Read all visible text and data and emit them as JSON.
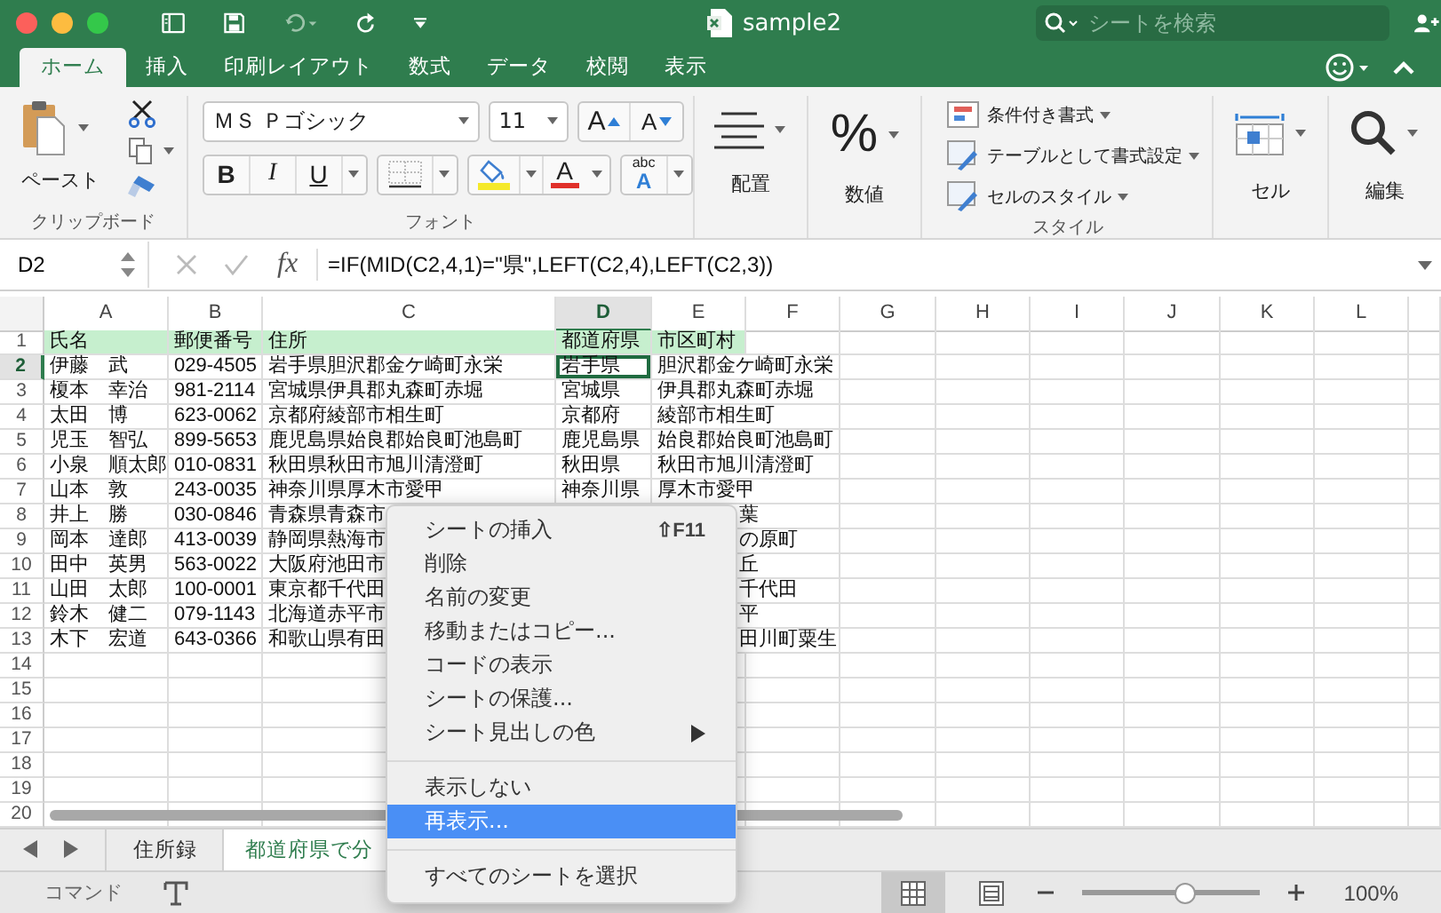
{
  "window": {
    "title": "sample2"
  },
  "search": {
    "placeholder": "シートを検索"
  },
  "tabs": [
    {
      "label": "ホーム",
      "selected": true
    },
    {
      "label": "挿入",
      "selected": false
    },
    {
      "label": "印刷レイアウト",
      "selected": false
    },
    {
      "label": "数式",
      "selected": false
    },
    {
      "label": "データ",
      "selected": false
    },
    {
      "label": "校閲",
      "selected": false
    },
    {
      "label": "表示",
      "selected": false
    }
  ],
  "ribbon": {
    "clipboard": {
      "paste": "ペースト",
      "label": "クリップボード"
    },
    "font": {
      "name": "ＭＳ Ｐゴシック",
      "size": "11",
      "grow": "A",
      "shrink": "A",
      "bold": "B",
      "italic": "I",
      "underline": "U",
      "font_color": "A",
      "phonetic_top": "abc",
      "phonetic_letter": "A",
      "label": "フォント"
    },
    "alignment": {
      "label": "配置"
    },
    "number": {
      "symbol": "%",
      "label": "数値"
    },
    "styles": {
      "items": [
        "条件付き書式",
        "テーブルとして書式設定",
        "セルのスタイル"
      ],
      "label": "スタイル"
    },
    "cells": {
      "label": "セル"
    },
    "editing": {
      "label": "編集"
    }
  },
  "formula_bar": {
    "name_box": "D2",
    "fx": "fx",
    "formula": "=IF(MID(C2,4,1)=\"県\",LEFT(C2,4),LEFT(C2,3))"
  },
  "sheet": {
    "columns": [
      {
        "label": "A",
        "selected": false
      },
      {
        "label": "B",
        "selected": false
      },
      {
        "label": "C",
        "selected": false
      },
      {
        "label": "D",
        "selected": true
      },
      {
        "label": "E",
        "selected": false
      },
      {
        "label": "F",
        "selected": false
      },
      {
        "label": "G",
        "selected": false
      },
      {
        "label": "H",
        "selected": false
      },
      {
        "label": "I",
        "selected": false
      },
      {
        "label": "J",
        "selected": false
      },
      {
        "label": "K",
        "selected": false
      },
      {
        "label": "L",
        "selected": false
      }
    ],
    "rows": [
      {
        "num": "1",
        "selected": false,
        "kind": "header",
        "cells": [
          "氏名",
          "郵便番号",
          "住所",
          "都道府県",
          "市区町村"
        ]
      },
      {
        "num": "2",
        "selected": true,
        "kind": "data",
        "cells": [
          "伊藤　武",
          "029-4505",
          "岩手県胆沢郡金ケ崎町永栄",
          "岩手県",
          "胆沢郡金ケ崎町永栄"
        ]
      },
      {
        "num": "3",
        "selected": false,
        "kind": "data",
        "cells": [
          "榎本　幸治",
          "981-2114",
          "宮城県伊具郡丸森町赤堀",
          "宮城県",
          "伊具郡丸森町赤堀"
        ]
      },
      {
        "num": "4",
        "selected": false,
        "kind": "data",
        "cells": [
          "太田　博",
          "623-0062",
          "京都府綾部市相生町",
          "京都府",
          "綾部市相生町"
        ]
      },
      {
        "num": "5",
        "selected": false,
        "kind": "data",
        "cells": [
          "児玉　智弘",
          "899-5653",
          "鹿児島県始良郡始良町池島町",
          "鹿児島県",
          "始良郡始良町池島町"
        ]
      },
      {
        "num": "6",
        "selected": false,
        "kind": "data",
        "cells": [
          "小泉　順太郎",
          "010-0831",
          "秋田県秋田市旭川清澄町",
          "秋田県",
          "秋田市旭川清澄町"
        ]
      },
      {
        "num": "7",
        "selected": false,
        "kind": "data",
        "cells": [
          "山本　敦",
          "243-0035",
          "神奈川県厚木市愛甲",
          "神奈川県",
          "厚木市愛甲"
        ]
      },
      {
        "num": "8",
        "selected": false,
        "kind": "data",
        "cells": [
          "井上　勝",
          "030-0846",
          "青森県青森市",
          null,
          "葉"
        ]
      },
      {
        "num": "9",
        "selected": false,
        "kind": "data",
        "cells": [
          "岡本　達郎",
          "413-0039",
          "静岡県熱海市",
          null,
          "の原町"
        ]
      },
      {
        "num": "10",
        "selected": false,
        "kind": "data",
        "cells": [
          "田中　英男",
          "563-0022",
          "大阪府池田市",
          null,
          "丘"
        ]
      },
      {
        "num": "11",
        "selected": false,
        "kind": "data",
        "cells": [
          "山田　太郎",
          "100-0001",
          "東京都千代田",
          null,
          "千代田"
        ]
      },
      {
        "num": "12",
        "selected": false,
        "kind": "data",
        "cells": [
          "鈴木　健二",
          "079-1143",
          "北海道赤平市",
          null,
          "平"
        ]
      },
      {
        "num": "13",
        "selected": false,
        "kind": "data",
        "cells": [
          "木下　宏道",
          "643-0366",
          "和歌山県有田",
          null,
          "田川町粟生"
        ]
      },
      {
        "num": "14",
        "selected": false,
        "kind": "empty"
      },
      {
        "num": "15",
        "selected": false,
        "kind": "empty"
      },
      {
        "num": "16",
        "selected": false,
        "kind": "empty"
      },
      {
        "num": "17",
        "selected": false,
        "kind": "empty"
      },
      {
        "num": "18",
        "selected": false,
        "kind": "empty"
      },
      {
        "num": "19",
        "selected": false,
        "kind": "empty"
      },
      {
        "num": "20",
        "selected": false,
        "kind": "empty"
      }
    ]
  },
  "context_menu": [
    {
      "kind": "item",
      "label": "シートの挿入",
      "shortcut": "⇧F11",
      "submenu": false,
      "selected": false
    },
    {
      "kind": "item",
      "label": "削除",
      "submenu": false,
      "selected": false
    },
    {
      "kind": "item",
      "label": "名前の変更",
      "submenu": false,
      "selected": false
    },
    {
      "kind": "item",
      "label": "移動またはコピー...",
      "submenu": false,
      "selected": false
    },
    {
      "kind": "item",
      "label": "コードの表示",
      "submenu": false,
      "selected": false
    },
    {
      "kind": "item",
      "label": "シートの保護...",
      "submenu": false,
      "selected": false
    },
    {
      "kind": "item",
      "label": "シート見出しの色",
      "submenu": true,
      "selected": false
    },
    {
      "kind": "separator"
    },
    {
      "kind": "item",
      "label": "表示しない",
      "submenu": false,
      "selected": false
    },
    {
      "kind": "item",
      "label": "再表示...",
      "submenu": false,
      "selected": true
    },
    {
      "kind": "separator"
    },
    {
      "kind": "item",
      "label": "すべてのシートを選択",
      "submenu": false,
      "selected": false
    }
  ],
  "sheet_tabs": [
    {
      "label": "住所録",
      "selected": false
    },
    {
      "label": "都道府県で分",
      "selected": true
    }
  ],
  "status_bar": {
    "mode": "コマンド",
    "views": [
      {
        "kind": "normal",
        "selected": true
      },
      {
        "kind": "page_layout",
        "selected": false
      }
    ],
    "zoom": {
      "level": 0.57,
      "reading": "100%"
    }
  }
}
